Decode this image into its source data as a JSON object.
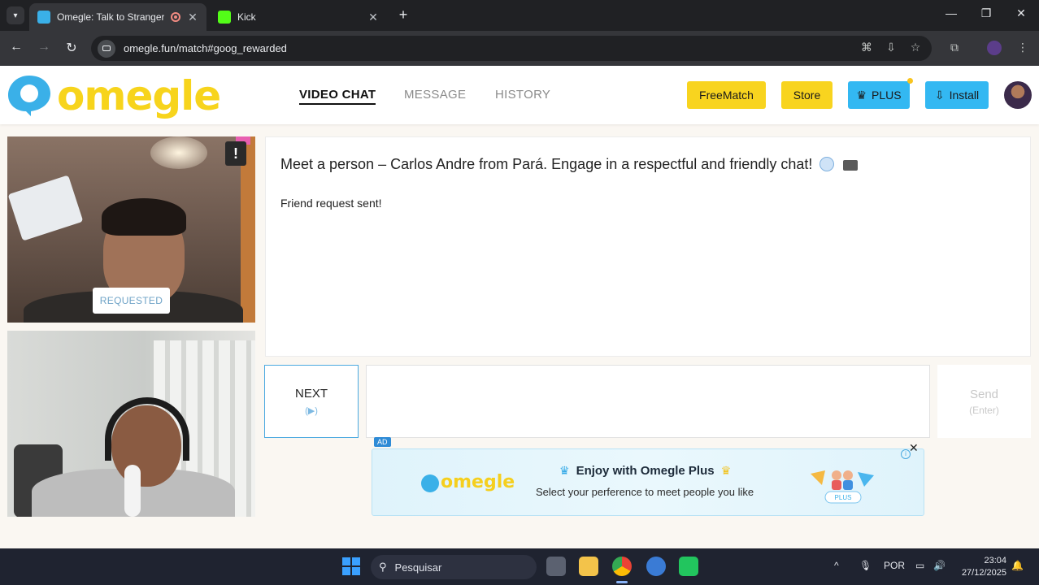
{
  "browser": {
    "tabs": [
      {
        "title": "Omegle: Talk to Strangers w",
        "active": true
      },
      {
        "title": "Kick",
        "active": false
      }
    ],
    "url": "omegle.fun/match#goog_rewarded"
  },
  "site": {
    "logo_text": "omegle",
    "nav": [
      {
        "label": "VIDEO CHAT",
        "active": true
      },
      {
        "label": "MESSAGE",
        "active": false
      },
      {
        "label": "HISTORY",
        "active": false
      }
    ],
    "buttons": {
      "freematch": "FreeMatch",
      "store": "Store",
      "plus": "PLUS",
      "install": "Install"
    },
    "colors": {
      "brand_yellow": "#f8d41f",
      "brand_blue": "#33b8f2"
    }
  },
  "stranger_video": {
    "requested_label": "REQUESTED",
    "report_icon": "!"
  },
  "chat": {
    "headline": "Meet a person – Carlos Andre from Pará. Engage in a respectful and friendly chat!",
    "status": "Friend request sent!",
    "next_label": "NEXT",
    "next_hint": "(▶)",
    "send_label": "Send",
    "send_hint": "(Enter)",
    "message_placeholder": ""
  },
  "ad": {
    "label": "AD",
    "logo_text": "omegle",
    "title": "Enjoy with Omegle Plus",
    "subtitle": "Select your perference to meet people you like",
    "badge": "PLUS",
    "close": "✕",
    "info": "i"
  },
  "taskbar": {
    "search_placeholder": "Pesquisar",
    "language": "POR",
    "time": "23:04",
    "date": "27/12/2025"
  }
}
